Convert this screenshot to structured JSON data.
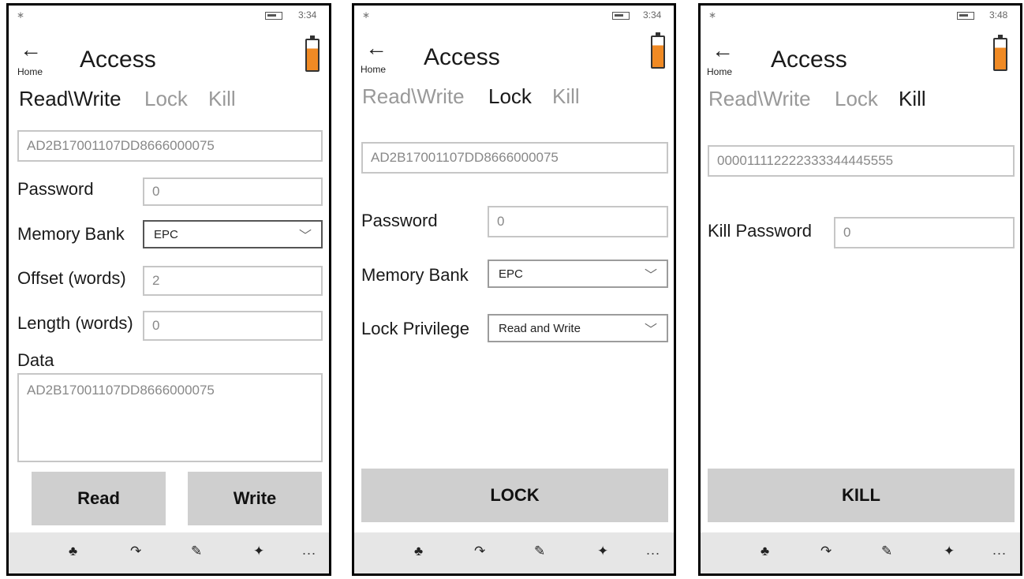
{
  "status": {
    "bluetooth_icon": "bluetooth-icon",
    "battery_icon": "battery-icon",
    "times": [
      "3:34",
      "3:34",
      "3:48"
    ]
  },
  "header": {
    "back_glyph": "←",
    "home_label": "Home",
    "title": "Access"
  },
  "tabs": [
    "Read\\Write",
    "Lock",
    "Kill"
  ],
  "read_write": {
    "epc": "AD2B17001107DD8666000075",
    "password_label": "Password",
    "password_value": "0",
    "memory_bank_label": "Memory Bank",
    "memory_bank_value": "EPC",
    "offset_label": "Offset (words)",
    "offset_value": "2",
    "length_label": "Length (words)",
    "length_value": "0",
    "data_label": "Data",
    "data_value": "AD2B17001107DD8666000075",
    "read_button": "Read",
    "write_button": "Write"
  },
  "lock": {
    "epc": "AD2B17001107DD8666000075",
    "password_label": "Password",
    "password_value": "0",
    "memory_bank_label": "Memory Bank",
    "memory_bank_value": "EPC",
    "privilege_label": "Lock Privilege",
    "privilege_value": "Read and Write",
    "lock_button": "LOCK"
  },
  "kill": {
    "epc": "000011112222333344445555",
    "kill_password_label": "Kill Password",
    "kill_password_value": "0",
    "kill_button": "KILL"
  },
  "appbar": {
    "icons": [
      "inventory-icon",
      "locate-icon",
      "write-icon",
      "pin-icon"
    ],
    "more": "..."
  },
  "colors": {
    "battery_fill": "#f08a24",
    "button_bg": "#cfcfcf",
    "appbar_bg": "#e6e6e6"
  }
}
